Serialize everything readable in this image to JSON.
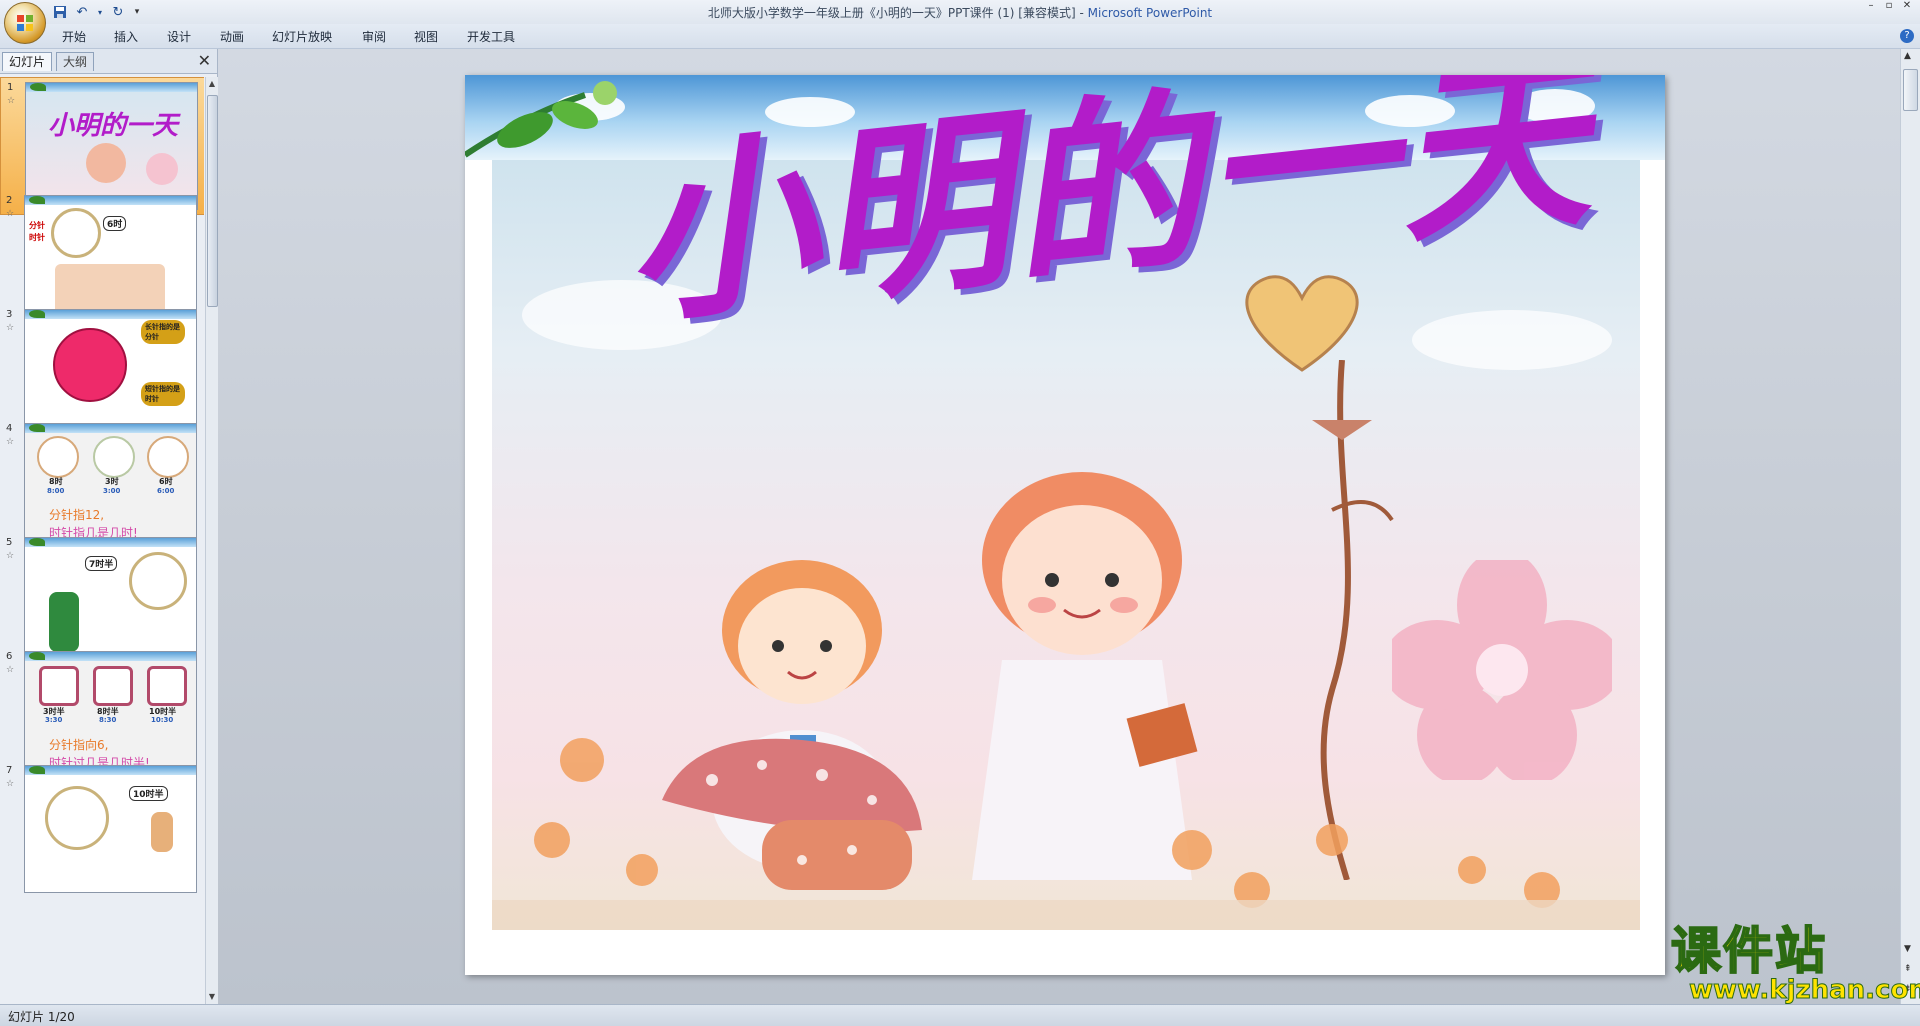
{
  "window": {
    "title": "北师大版小学数学一年级上册《小明的一天》PPT课件 (1) [兼容模式] - ",
    "app_name": "Microsoft PowerPoint"
  },
  "ribbon": {
    "tabs": [
      "开始",
      "插入",
      "设计",
      "动画",
      "幻灯片放映",
      "审阅",
      "视图",
      "开发工具"
    ]
  },
  "left_pane": {
    "tabs": [
      "幻灯片",
      "大纲"
    ],
    "thumbnails": [
      {
        "number": "1",
        "caption": "小明的一天",
        "selected": true
      },
      {
        "number": "2",
        "caption": "6时",
        "labels": [
          "分针",
          "时针"
        ]
      },
      {
        "number": "3",
        "caption": "长针指的是分针",
        "caption2": "短针指的是时针"
      },
      {
        "number": "4",
        "times": [
          "8时",
          "3时",
          "6时"
        ],
        "digital": [
          "8:00",
          "3:00",
          "6:00"
        ],
        "line1": "分针指12,",
        "line2": "时针指几是几时!"
      },
      {
        "number": "5",
        "caption": "7时半"
      },
      {
        "number": "6",
        "times": [
          "3时半",
          "8时半",
          "10时半"
        ],
        "digital": [
          "3:30",
          "8:30",
          "10:30"
        ],
        "line1": "分针指向6,",
        "line2": "时针过几是几时半!"
      },
      {
        "number": "7",
        "caption": "10时半"
      }
    ]
  },
  "slide": {
    "title": "小明的一天"
  },
  "status_bar": {
    "slide_indicator": "幻灯片 1/20"
  },
  "watermark": {
    "brand": "课件站",
    "url": "www.kjzhan.com"
  },
  "colors": {
    "title_purple": "#b21cc9",
    "title_shadow": "#7a66d6",
    "selected_thumb": "#f5b049",
    "watermark_yellow": "#ffe300"
  }
}
